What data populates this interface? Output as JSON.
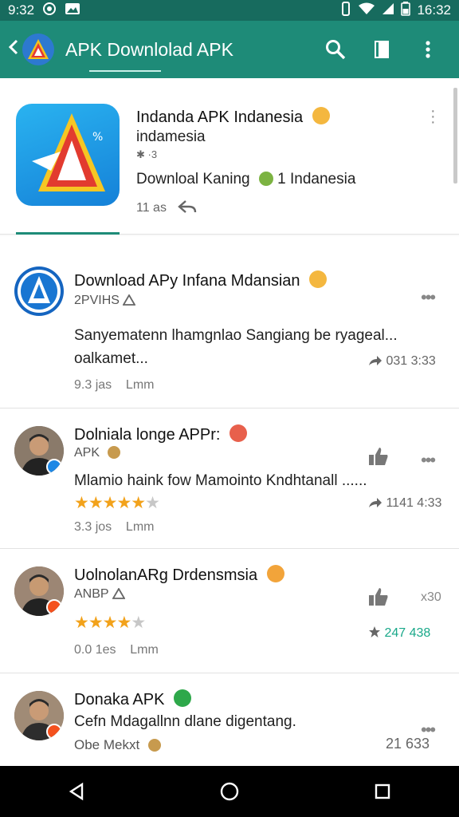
{
  "status": {
    "time_left": "9:32",
    "time_right": "16:32"
  },
  "appbar": {
    "title": "APK Downlolad APK"
  },
  "featured": {
    "title": "Indanda APK Indanesia",
    "subtitle": "indamesia",
    "meta": "✱ ·3",
    "description": "Downloal Kaning",
    "desc_suffix": "1 Indanesia",
    "time": "11 as"
  },
  "posts": [
    {
      "name": "Download APy Infana Mdansian",
      "sub": "2PVIHS",
      "text_line1": "Sanyematenn lhamgnlao Sangiang be ryageal...",
      "text_line2": "oalkamet...",
      "time": "9.3 jas",
      "time2": "Lmm",
      "share": "031 3:33"
    },
    {
      "name": "Dolniala longe APPr:",
      "sub": "APK",
      "text_line1": "Mlamio haink fow Mamointo Kndhtanall ......",
      "rating": 5,
      "time": "3.3 jos",
      "time2": "Lmm",
      "share": "1141 4:33"
    },
    {
      "name": "UolnolanARg Drdensmsia",
      "sub": "ANBP",
      "rating": 4,
      "time": "0.0 1es",
      "time2": "Lmm",
      "share": "247 438",
      "more": "x30"
    },
    {
      "name": "Donaka APK",
      "text_line1": "Cefn Mdagallnn dlane digentang.",
      "sub": "Obe Mekxt",
      "share": "21 633"
    }
  ],
  "colors": {
    "primary": "#1e8b78",
    "statusbar": "#176b5e",
    "star": "#f2a21b",
    "accent_green": "#19a889"
  }
}
